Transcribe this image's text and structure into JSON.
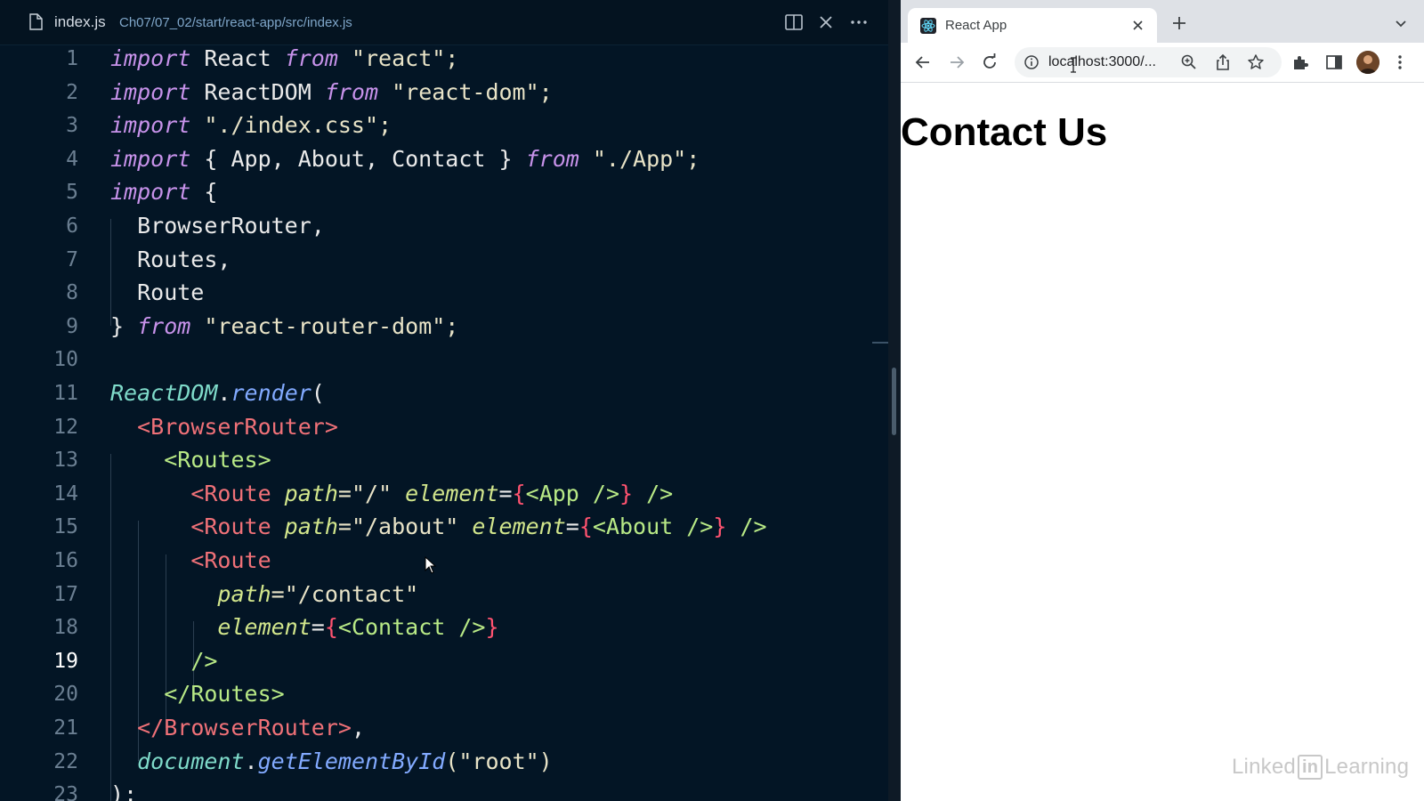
{
  "editor": {
    "filename": "index.js",
    "path": "Ch07/07_02/start/react-app/src/index.js",
    "active_line": 19,
    "lines": [
      {
        "n": "1",
        "tokens": [
          {
            "t": "import",
            "c": "k"
          },
          {
            "t": " React ",
            "c": "id"
          },
          {
            "t": "from",
            "c": "k"
          },
          {
            "t": " \"react\";",
            "c": "s"
          }
        ]
      },
      {
        "n": "2",
        "tokens": [
          {
            "t": "import",
            "c": "k"
          },
          {
            "t": " ReactDOM ",
            "c": "id"
          },
          {
            "t": "from",
            "c": "k"
          },
          {
            "t": " \"react-dom\";",
            "c": "s"
          }
        ]
      },
      {
        "n": "3",
        "tokens": [
          {
            "t": "import",
            "c": "k"
          },
          {
            "t": " \"./index.css\";",
            "c": "s"
          }
        ]
      },
      {
        "n": "4",
        "tokens": [
          {
            "t": "import",
            "c": "k"
          },
          {
            "t": " { App, About, Contact } ",
            "c": "id"
          },
          {
            "t": "from",
            "c": "k"
          },
          {
            "t": " \"./App\";",
            "c": "s"
          }
        ]
      },
      {
        "n": "5",
        "tokens": [
          {
            "t": "import",
            "c": "k"
          },
          {
            "t": " {",
            "c": "id"
          }
        ]
      },
      {
        "n": "6",
        "tokens": [
          {
            "t": "  BrowserRouter,",
            "c": "id"
          }
        ]
      },
      {
        "n": "7",
        "tokens": [
          {
            "t": "  Routes,",
            "c": "id"
          }
        ]
      },
      {
        "n": "8",
        "tokens": [
          {
            "t": "  Route",
            "c": "id"
          }
        ]
      },
      {
        "n": "9",
        "tokens": [
          {
            "t": "} ",
            "c": "id"
          },
          {
            "t": "from",
            "c": "k"
          },
          {
            "t": " \"react-router-dom\";",
            "c": "s"
          }
        ]
      },
      {
        "n": "10",
        "tokens": []
      },
      {
        "n": "11",
        "tokens": [
          {
            "t": "ReactDOM",
            "c": "o"
          },
          {
            "t": ".",
            "c": "p"
          },
          {
            "t": "render",
            "c": "f"
          },
          {
            "t": "(",
            "c": "p"
          }
        ]
      },
      {
        "n": "12",
        "tokens": [
          {
            "t": "  ",
            "c": "p"
          },
          {
            "t": "<BrowserRouter>",
            "c": "t"
          }
        ]
      },
      {
        "n": "13",
        "tokens": [
          {
            "t": "    ",
            "c": "p"
          },
          {
            "t": "<Routes>",
            "c": "tc"
          }
        ]
      },
      {
        "n": "14",
        "tokens": [
          {
            "t": "      ",
            "c": "p"
          },
          {
            "t": "<Route ",
            "c": "t"
          },
          {
            "t": "path",
            "c": "a"
          },
          {
            "t": "=\"/\" ",
            "c": "s"
          },
          {
            "t": "element",
            "c": "a"
          },
          {
            "t": "=",
            "c": "p"
          },
          {
            "t": "{",
            "c": "br"
          },
          {
            "t": "<App />",
            "c": "tc"
          },
          {
            "t": "}",
            "c": "br"
          },
          {
            "t": " />",
            "c": "tc"
          }
        ]
      },
      {
        "n": "15",
        "tokens": [
          {
            "t": "      ",
            "c": "p"
          },
          {
            "t": "<Route ",
            "c": "t"
          },
          {
            "t": "path",
            "c": "a"
          },
          {
            "t": "=\"/about\" ",
            "c": "s"
          },
          {
            "t": "element",
            "c": "a"
          },
          {
            "t": "=",
            "c": "p"
          },
          {
            "t": "{",
            "c": "br"
          },
          {
            "t": "<About />",
            "c": "tc"
          },
          {
            "t": "}",
            "c": "br"
          },
          {
            "t": " />",
            "c": "tc"
          }
        ]
      },
      {
        "n": "16",
        "tokens": [
          {
            "t": "      ",
            "c": "p"
          },
          {
            "t": "<Route",
            "c": "t"
          }
        ]
      },
      {
        "n": "17",
        "tokens": [
          {
            "t": "        ",
            "c": "p"
          },
          {
            "t": "path",
            "c": "a"
          },
          {
            "t": "=\"/contact\"",
            "c": "s"
          }
        ]
      },
      {
        "n": "18",
        "tokens": [
          {
            "t": "        ",
            "c": "p"
          },
          {
            "t": "element",
            "c": "a"
          },
          {
            "t": "=",
            "c": "p"
          },
          {
            "t": "{",
            "c": "br"
          },
          {
            "t": "<Contact />",
            "c": "tc"
          },
          {
            "t": "}",
            "c": "br"
          }
        ]
      },
      {
        "n": "19",
        "tokens": [
          {
            "t": "      ",
            "c": "p"
          },
          {
            "t": "/>",
            "c": "tc"
          }
        ]
      },
      {
        "n": "20",
        "tokens": [
          {
            "t": "    ",
            "c": "p"
          },
          {
            "t": "</Routes>",
            "c": "tc"
          }
        ]
      },
      {
        "n": "21",
        "tokens": [
          {
            "t": "  ",
            "c": "p"
          },
          {
            "t": "</BrowserRouter>",
            "c": "t"
          },
          {
            "t": ",",
            "c": "p"
          }
        ]
      },
      {
        "n": "22",
        "tokens": [
          {
            "t": "  ",
            "c": "p"
          },
          {
            "t": "document",
            "c": "o"
          },
          {
            "t": ".",
            "c": "p"
          },
          {
            "t": "getElementById",
            "c": "f"
          },
          {
            "t": "(\"root\")",
            "c": "s"
          }
        ]
      },
      {
        "n": "23",
        "tokens": [
          {
            "t": ");",
            "c": "p"
          }
        ]
      }
    ]
  },
  "browser": {
    "tab_title": "React App",
    "url": "localhost:3000/...",
    "page_heading": "Contact Us"
  },
  "watermark": {
    "left": "Linked",
    "badge": "in",
    "right": "Learning"
  },
  "colors": {
    "editor_bg": "#031525",
    "keyword": "#c792ea",
    "tag": "#f07178",
    "string": "#e8e3c7",
    "browser_tabstrip": "#dee1e6"
  }
}
